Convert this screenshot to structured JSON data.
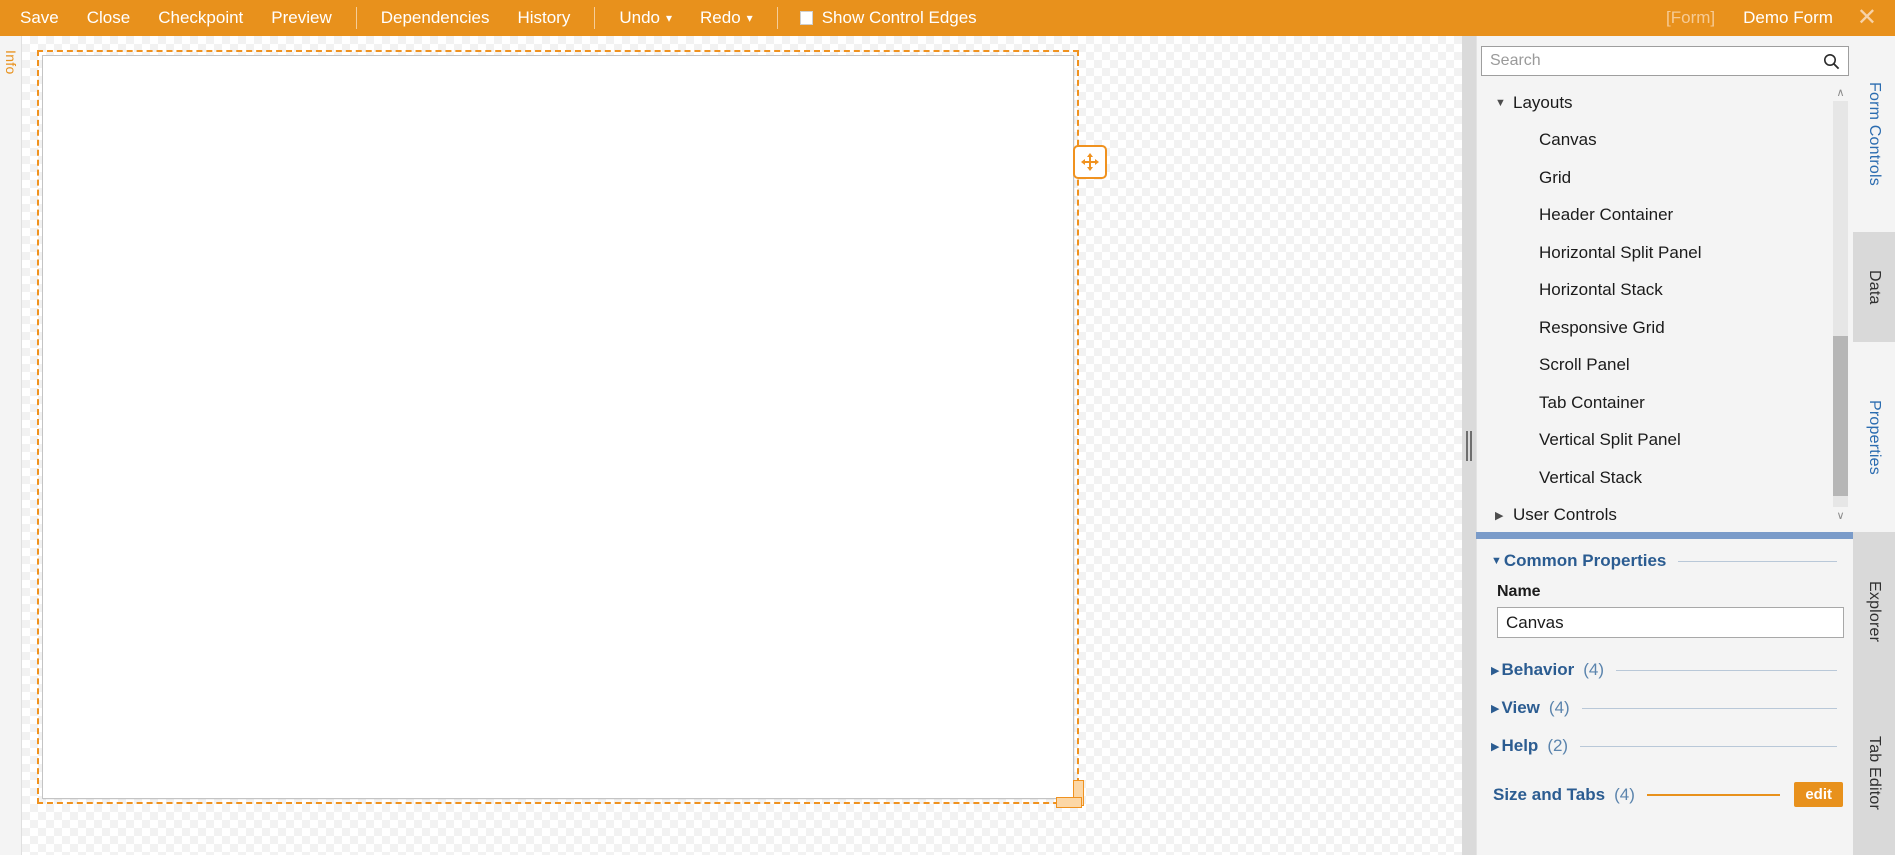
{
  "toolbar": {
    "items": [
      {
        "label": "Save",
        "name": "save-button"
      },
      {
        "label": "Close",
        "name": "close-button"
      },
      {
        "label": "Checkpoint",
        "name": "checkpoint-button"
      },
      {
        "label": "Preview",
        "name": "preview-button"
      },
      {
        "label": "Dependencies",
        "name": "dependencies-button"
      },
      {
        "label": "History",
        "name": "history-button"
      },
      {
        "label": "Undo",
        "name": "undo-button"
      },
      {
        "label": "Redo",
        "name": "redo-button"
      }
    ],
    "undo_label": "Undo",
    "redo_label": "Redo",
    "show_control_edges_label": "Show Control Edges",
    "show_control_edges_checked": false,
    "form_tag": "[Form]",
    "form_title": "Demo Form",
    "close_glyph": "✕",
    "accent_color": "#e8911c"
  },
  "left_rail": {
    "tabs": [
      {
        "label": "Info",
        "name": "left-tab-info",
        "active": true
      }
    ]
  },
  "design_surface": {
    "selected_control": "Canvas",
    "move_handle_icon": "move-cross-icon",
    "resize_handle_icon": "resize-corner-icon"
  },
  "palette": {
    "search": {
      "value": "",
      "placeholder": "Search",
      "icon": "search-icon"
    },
    "groups": [
      {
        "label": "Layouts",
        "expanded": true,
        "twisty": "▼",
        "items": [
          "Canvas",
          "Grid",
          "Header Container",
          "Horizontal Split Panel",
          "Horizontal Stack",
          "Responsive Grid",
          "Scroll Panel",
          "Tab Container",
          "Vertical Split Panel",
          "Vertical Stack"
        ]
      },
      {
        "label": "User Controls",
        "expanded": false,
        "twisty": "▶",
        "items": []
      }
    ],
    "scrollbar": {
      "up_arrow": "∧",
      "down_arrow": "∨"
    }
  },
  "properties": {
    "sections": [
      {
        "title": "Common Properties",
        "count": "",
        "expanded": true,
        "twisty": "▼",
        "name": "section-common-properties"
      },
      {
        "title": "Behavior",
        "count": "(4)",
        "expanded": false,
        "twisty": "▶",
        "name": "section-behavior"
      },
      {
        "title": "View",
        "count": "(4)",
        "expanded": false,
        "twisty": "▶",
        "name": "section-view"
      },
      {
        "title": "Help",
        "count": "(2)",
        "expanded": false,
        "twisty": "▶",
        "name": "section-help"
      },
      {
        "title": "Size and Tabs",
        "count": "(4)",
        "expanded": false,
        "twisty": "",
        "name": "section-size-and-tabs"
      }
    ],
    "name_field": {
      "label": "Name",
      "value": "Canvas"
    },
    "edit_button_label": "edit"
  },
  "right_rail": {
    "tabs": [
      {
        "label": "Form Controls",
        "active": true,
        "name": "right-tab-form-controls"
      },
      {
        "label": "Data",
        "active": false,
        "name": "right-tab-data"
      },
      {
        "label": "Properties",
        "active": true,
        "name": "right-tab-properties"
      },
      {
        "label": "Explorer",
        "active": false,
        "name": "right-tab-explorer"
      },
      {
        "label": "Tab Editor",
        "active": false,
        "name": "right-tab-tab-editor"
      }
    ]
  }
}
